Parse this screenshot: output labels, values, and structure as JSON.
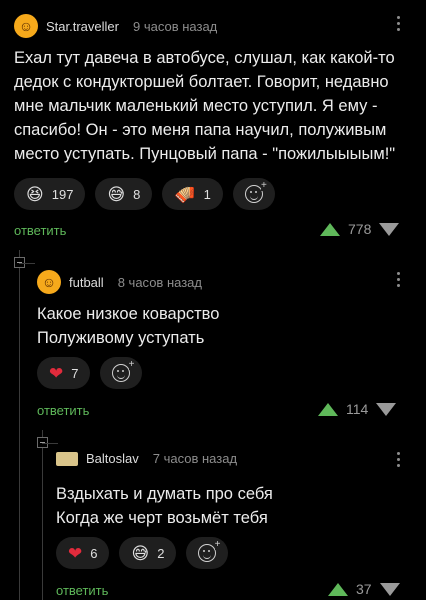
{
  "comments": [
    {
      "username": "Star.traveller",
      "time": "9 часов назад",
      "text": "Ехал тут давеча в автобусе, слушал, как какой-то дедок с кондукторшей болтает. Говорит, недавно мне мальчик маленький место уступил. Я ему - спасибо! Он - это меня папа научил, полуживым место уступать. Пунцовый папа - \"пожилыыыым!\"",
      "reactions": [
        {
          "emoji": "😆",
          "icon": "laughing-emoji",
          "count": "197"
        },
        {
          "emoji": "😅",
          "icon": "sweat-smile-emoji",
          "count": "8"
        },
        {
          "emoji": "🪗",
          "icon": "accordion-emoji",
          "count": "1"
        }
      ],
      "reply": "ответить",
      "votes": "778"
    },
    {
      "username": "futball",
      "time": "8 часов назад",
      "lines": [
        "Какое низкое коварство",
        "Полуживому уступать"
      ],
      "reactions": [
        {
          "emoji": "❤",
          "icon": "heart-emoji",
          "count": "7"
        }
      ],
      "reply": "ответить",
      "votes": "114"
    },
    {
      "username": "Baltoslav",
      "time": "7 часов назад",
      "lines": [
        "Вздыхать и думать про себя",
        "Когда же черт возьмёт тебя"
      ],
      "reactions": [
        {
          "emoji": "❤",
          "icon": "heart-emoji",
          "count": "6"
        },
        {
          "emoji": "😅",
          "icon": "sweat-smile-emoji",
          "count": "2"
        }
      ],
      "reply": "ответить",
      "votes": "37"
    }
  ],
  "colors": {
    "background": "#000000",
    "accent_green": "#5fb85a",
    "heart_red": "#e12b3c",
    "pill_bg": "#1f1f1f"
  }
}
